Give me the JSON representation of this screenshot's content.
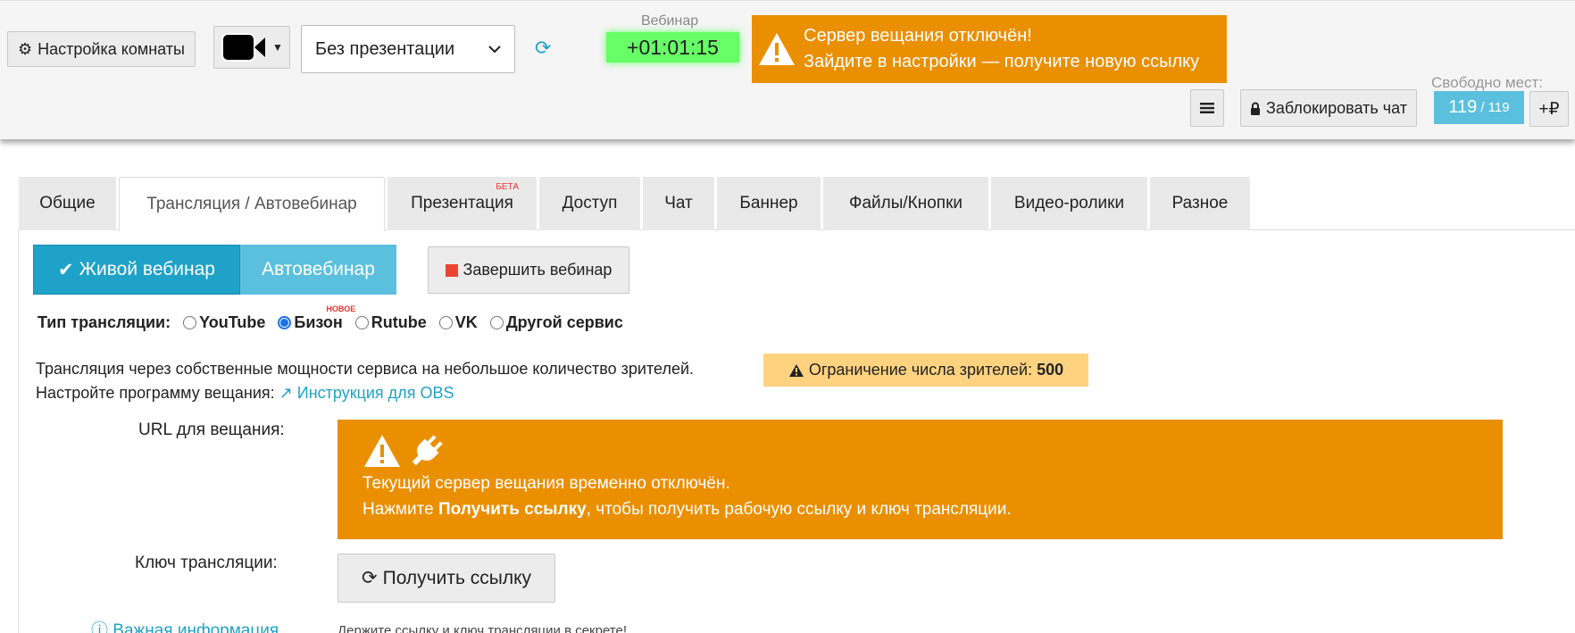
{
  "header": {
    "room_settings_label": "Настройка комнаты",
    "presentation_select": {
      "value": "Без презентации"
    },
    "webinar_label": "Вебинар",
    "timer": "+01:01:15",
    "server_alert": {
      "line1": "Сервер вещания отключён!",
      "line2": "Зайдите в настройки — получите новую ссылку"
    },
    "lock_chat_label": "Заблокировать чат",
    "seats_label": "Свободно мест:",
    "seats_free": "119",
    "seats_total": "/ 119",
    "add_rub_label": "+₽"
  },
  "tabs": [
    {
      "label": "Общие"
    },
    {
      "label": "Трансляция / Автовебинар",
      "active": true
    },
    {
      "label": "Презентация",
      "badge": "БЕТА"
    },
    {
      "label": "Доступ"
    },
    {
      "label": "Чат"
    },
    {
      "label": "Баннер"
    },
    {
      "label": "Файлы/Кнопки"
    },
    {
      "label": "Видео-ролики"
    },
    {
      "label": "Разное"
    }
  ],
  "broadcast": {
    "mode_live_label": "Живой вебинар",
    "mode_auto_label": "Автовебинар",
    "end_webinar_label": "Завершить вебинар",
    "type_label": "Тип трансляции:",
    "types": [
      {
        "label": "YouTube",
        "checked": false
      },
      {
        "label": "Бизон",
        "checked": true,
        "badge": "НОВОЕ"
      },
      {
        "label": "Rutube",
        "checked": false
      },
      {
        "label": "VK",
        "checked": false
      },
      {
        "label": "Другой сервис",
        "checked": false
      }
    ],
    "description": "Трансляция через собственные мощности сервиса на небольшое количество зрителей.",
    "limit_label": "Ограничение числа зрителей:",
    "limit_value": "500",
    "setup_text": "Настройте программу вещания:",
    "obs_link": "Инструкция для OBS",
    "url_label": "URL для вещания:",
    "url_alert": {
      "line1": "Текущий сервер вещания временно отключён.",
      "line2_prefix": "Нажмите",
      "line2_bold": "Получить ссылку",
      "line2_suffix": ", чтобы получить рабочую ссылку и ключ трансляции."
    },
    "key_label": "Ключ трансляции:",
    "get_link_label": "Получить ссылку",
    "info_link": "Важная информация",
    "keep_secret_text": "Держите ссылку и ключ трансляции в секрете!"
  },
  "colors": {
    "accent": "#1fa2c7",
    "warning": "#ea8f00",
    "timer_bg": "#66ff66",
    "limit_bg": "#ffd27f"
  }
}
